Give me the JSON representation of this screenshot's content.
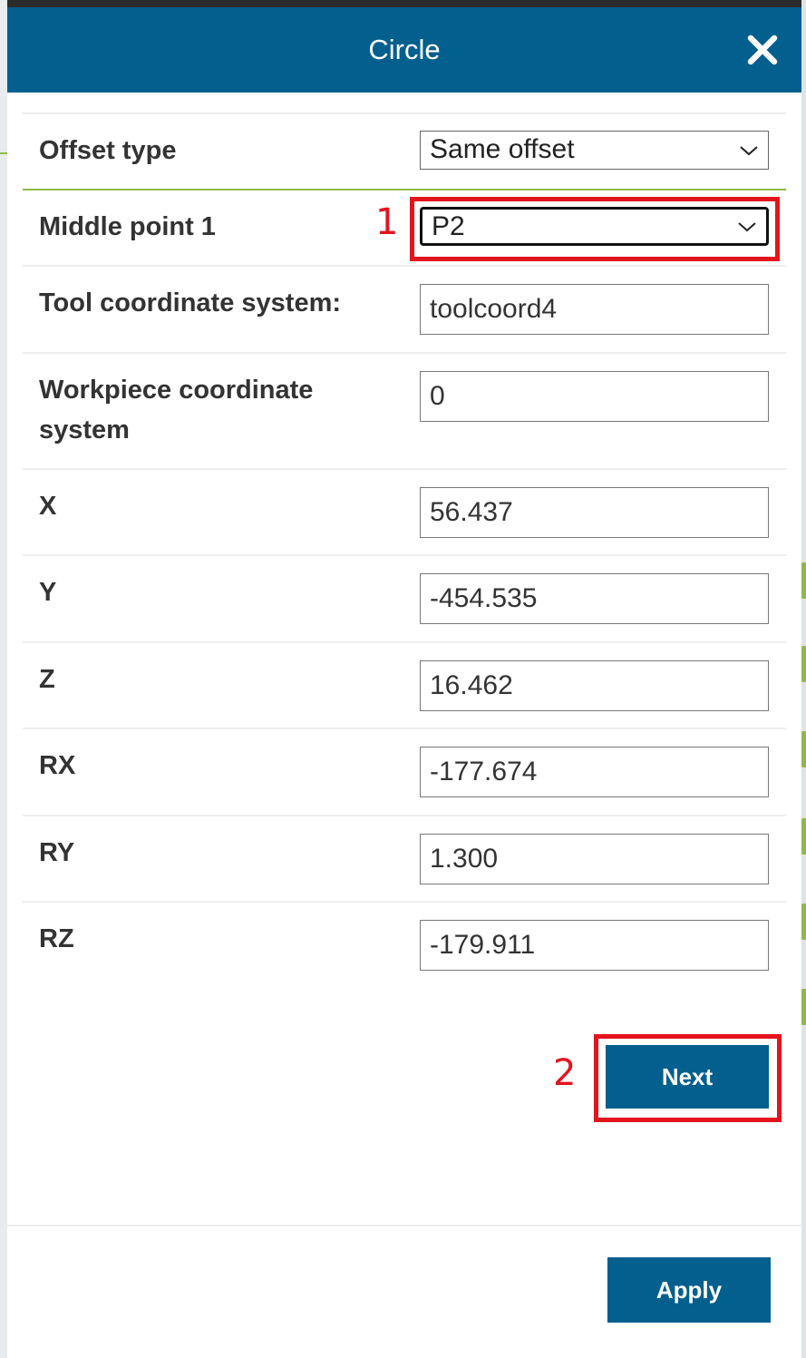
{
  "dialog": {
    "title": "Circle",
    "close_icon": "close-icon"
  },
  "form": {
    "offset_type": {
      "label": "Offset type",
      "value": "Same offset"
    },
    "middle_point": {
      "label": "Middle point 1",
      "value": "P2"
    },
    "tool_coord": {
      "label": "Tool coordinate system:",
      "value": "toolcoord4"
    },
    "workpiece_coord": {
      "label_line1": "Workpiece coordinate",
      "label_line2": "system",
      "value": "0"
    },
    "x": {
      "label": "X",
      "value": "56.437"
    },
    "y": {
      "label": "Y",
      "value": "-454.535"
    },
    "z": {
      "label": "Z",
      "value": "16.462"
    },
    "rx": {
      "label": "RX",
      "value": "-177.674"
    },
    "ry": {
      "label": "RY",
      "value": "1.300"
    },
    "rz": {
      "label": "RZ",
      "value": "-179.911"
    }
  },
  "buttons": {
    "next": "Next",
    "apply": "Apply"
  },
  "annotations": {
    "step1": "1",
    "step2": "2",
    "color": "#e3141e"
  },
  "colors": {
    "primary": "#035f8d",
    "accent_green": "#8cbb45"
  }
}
